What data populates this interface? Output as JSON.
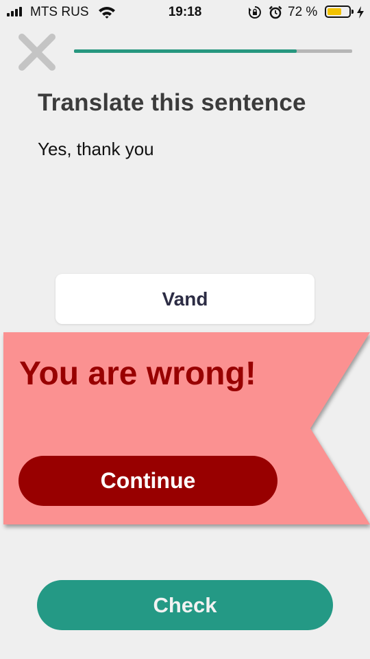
{
  "status_bar": {
    "carrier": "MTS RUS",
    "time": "19:18",
    "battery_percent": "72 %",
    "battery_level": 0.72,
    "icons": [
      "signal-icon",
      "wifi-icon",
      "rotation-lock-icon",
      "alarm-icon",
      "battery-icon",
      "charging-icon"
    ]
  },
  "header": {
    "close_icon": "close-icon",
    "progress": 0.8,
    "progress_color": "#27977f"
  },
  "exercise": {
    "instruction": "Translate this sentence",
    "sentence": "Yes, thank you",
    "answer": "Vand"
  },
  "feedback": {
    "message": "You are wrong!",
    "continue_label": "Continue",
    "background_color": "#fb9191",
    "accent_color": "#980000"
  },
  "footer": {
    "check_label": "Check",
    "check_color": "#249985"
  }
}
